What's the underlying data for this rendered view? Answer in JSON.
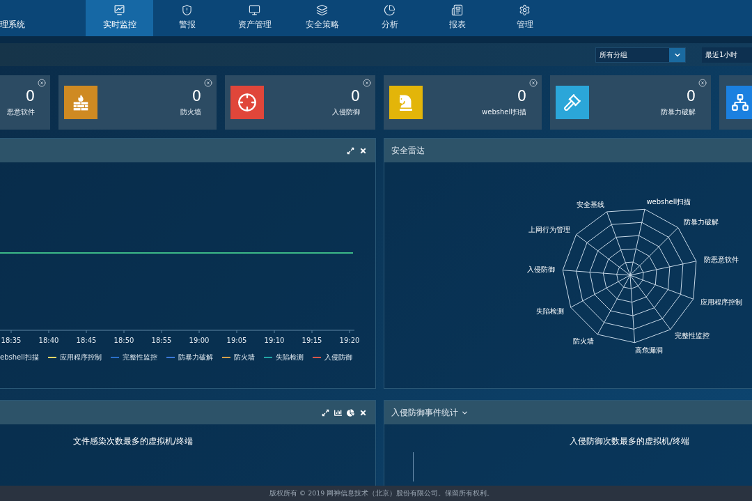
{
  "app_title": "理系统",
  "nav": [
    {
      "label": "实时监控",
      "selected": true
    },
    {
      "label": "警报",
      "selected": false
    },
    {
      "label": "资产管理",
      "selected": false
    },
    {
      "label": "安全策略",
      "selected": false
    },
    {
      "label": "分析",
      "selected": false
    },
    {
      "label": "报表",
      "selected": false
    },
    {
      "label": "管理",
      "selected": false
    }
  ],
  "filters": {
    "group": {
      "value": "所有分组"
    },
    "time_range": {
      "value": "最近1小时"
    }
  },
  "stat_cards": [
    {
      "value": "0",
      "label": "恶意软件",
      "closable": true
    },
    {
      "value": "0",
      "label": "防火墙",
      "color": "#cf8a22",
      "closable": true
    },
    {
      "value": "0",
      "label": "入侵防御",
      "color": "#e0463a",
      "closable": true
    },
    {
      "value": "0",
      "label": "webshell扫描",
      "color": "#e3b509",
      "closable": true
    },
    {
      "value": "0",
      "label": "防暴力破解",
      "color": "#2ba6d9",
      "closable": true
    },
    {
      "color": "#1b80e0"
    }
  ],
  "trend_panel": {
    "tools": [
      {
        "kind": "expand"
      },
      {
        "kind": "close"
      }
    ],
    "x_axis_labels": [
      "18:35",
      "18:40",
      "18:45",
      "18:50",
      "18:55",
      "19:00",
      "19:05",
      "19:10",
      "19:15",
      "19:20"
    ],
    "legend": [
      {
        "label": "ebshell扫描"
      },
      {
        "label": "应用程序控制",
        "color": "#e6d667"
      },
      {
        "label": "完整性监控",
        "color": "#2a6fc9"
      },
      {
        "label": "防暴力破解",
        "color": "#3b78d6"
      },
      {
        "label": "防火墙",
        "color": "#d6a04a"
      },
      {
        "label": "失陷检测",
        "color": "#22a5a5"
      },
      {
        "label": "入侵防御",
        "color": "#d9564a"
      }
    ]
  },
  "radar_panel": {
    "title": "安全雷达",
    "axes": [
      "安全基线",
      "webshell扫描",
      "防暴力破解",
      "上网行为管理",
      "防恶意软件",
      "入侵防御",
      "应用程序控制",
      "失陷检测",
      "完整性监控",
      "防火墙",
      "高危漏洞"
    ]
  },
  "infection_panel": {
    "tools": [
      {
        "kind": "expand"
      },
      {
        "kind": "bar_chart"
      },
      {
        "kind": "pie_chart"
      },
      {
        "kind": "close"
      }
    ],
    "subtitle": "文件感染次数最多的虚拟机/终端"
  },
  "intrusion_panel": {
    "title": "入侵防御事件统计",
    "menu": true,
    "subtitle": "入侵防御次数最多的虚拟机/终端"
  },
  "footer": {
    "text": "版权所有 © 2019 网神信息技术（北京）股份有限公司。保留所有权利。"
  }
}
